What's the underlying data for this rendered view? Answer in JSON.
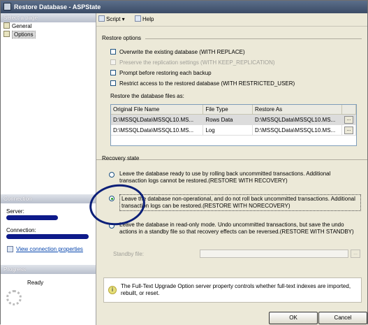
{
  "window": {
    "title": "Restore Database - ASPState"
  },
  "left": {
    "select_page_header": "Select a page",
    "pages": [
      {
        "label": "General",
        "icon": "page-icon"
      },
      {
        "label": "Options",
        "icon": "page-icon",
        "selected": true
      }
    ],
    "connection_header": "Connection",
    "server_label": "Server:",
    "connection_label": "Connection:",
    "view_connection_properties": "View connection properties",
    "progress_header": "Progress",
    "progress_status": "Ready"
  },
  "toolbar": {
    "script_label": "Script",
    "help_label": "Help"
  },
  "restore_options": {
    "header": "Restore options",
    "checkboxes": [
      {
        "label": "Overwrite the existing database (WITH REPLACE)",
        "checked": false,
        "enabled": true
      },
      {
        "label": "Preserve the replication settings (WITH KEEP_REPLICATION)",
        "checked": false,
        "enabled": false
      },
      {
        "label": "Prompt before restoring each backup",
        "checked": false,
        "enabled": true
      },
      {
        "label": "Restrict access to the restored database (WITH RESTRICTED_USER)",
        "checked": false,
        "enabled": true
      }
    ],
    "files_label": "Restore the database files as:",
    "columns": [
      "Original File Name",
      "File Type",
      "Restore As"
    ],
    "rows": [
      [
        "D:\\MSSQLData\\MSSQL10.MS...",
        "Rows Data",
        "D:\\MSSQLData\\MSSQL10.MS..."
      ],
      [
        "D:\\MSSQLData\\MSSQL10.MS...",
        "Log",
        "D:\\MSSQLData\\MSSQL10.MS..."
      ]
    ],
    "ellipsis": "..."
  },
  "recovery": {
    "header": "Recovery state",
    "options": [
      {
        "text": "Leave the database ready to use by rolling back uncommitted transactions. Additional transaction logs cannot be restored.(RESTORE WITH RECOVERY)",
        "selected": false
      },
      {
        "text": "Leave the database non-operational, and do not roll back uncommitted transactions. Additional transaction logs can be restored.(RESTORE WITH NORECOVERY)",
        "selected": true
      },
      {
        "text": "Leave the database in read-only mode. Undo uncommitted transactions, but save the undo actions in a standby file so that recovery effects can be reversed.(RESTORE WITH STANDBY)",
        "selected": false
      }
    ],
    "standby_label": "Standby file:"
  },
  "info": {
    "text": "The Full-Text Upgrade Option server property controls whether full-text indexes are imported, rebuilt, or reset."
  },
  "buttons": {
    "ok": "OK",
    "cancel": "Cancel"
  },
  "colors": {
    "title_bar": "#3b4c66",
    "annotation_circle": "#0b1f78",
    "redaction": "#0d1a8a"
  }
}
